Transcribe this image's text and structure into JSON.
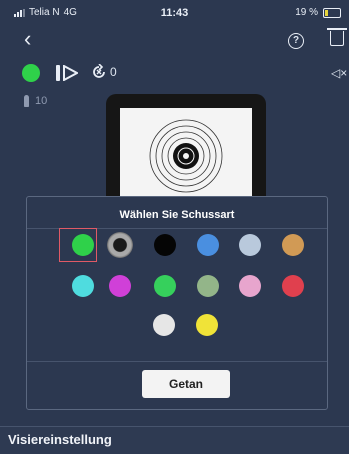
{
  "status_bar": {
    "carrier": "Telia N",
    "network": "4G",
    "time": "11:43",
    "battery": "19 %"
  },
  "toolbar": {
    "shot_count": "0"
  },
  "ammo": {
    "count": "10"
  },
  "shot_type_dialog": {
    "title": "Wählen Sie Schussart",
    "confirm_label": "Getan",
    "selected_index": 0,
    "options": [
      {
        "name": "green",
        "color": "#2fd14a"
      },
      {
        "name": "bullet-hole",
        "color": "#a9a9a9"
      },
      {
        "name": "black",
        "color": "#050505"
      },
      {
        "name": "blue",
        "color": "#4a8fe0"
      },
      {
        "name": "light-blue",
        "color": "#b9c9dc"
      },
      {
        "name": "tan",
        "color": "#d19a55"
      },
      {
        "name": "cyan",
        "color": "#4fdcdf"
      },
      {
        "name": "magenta",
        "color": "#d040d8"
      },
      {
        "name": "green-2",
        "color": "#36d05c"
      },
      {
        "name": "sage",
        "color": "#93b589"
      },
      {
        "name": "pink",
        "color": "#e7a5cd"
      },
      {
        "name": "red",
        "color": "#e0404e"
      },
      {
        "name": "white",
        "color": "#e6e6e6"
      },
      {
        "name": "yellow",
        "color": "#f0e338"
      }
    ]
  },
  "footer": {
    "label": "Visiereinstellung"
  }
}
